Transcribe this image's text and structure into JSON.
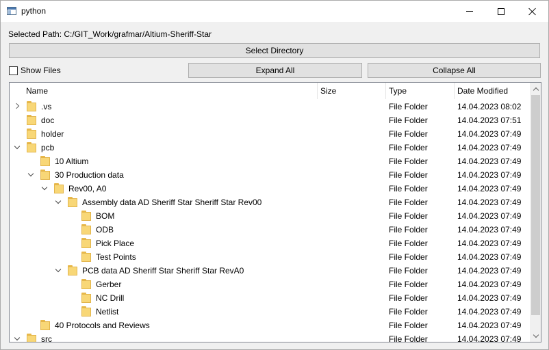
{
  "window": {
    "title": "python"
  },
  "selected_path": "Selected Path: C:/GIT_Work/grafmar/Altium-Sheriff-Star",
  "buttons": {
    "select_directory": "Select Directory",
    "expand_all": "Expand All",
    "collapse_all": "Collapse All"
  },
  "show_files": {
    "label": "Show Files",
    "checked": false
  },
  "tree": {
    "headers": {
      "name": "Name",
      "size": "Size",
      "type": "Type",
      "date": "Date Modified"
    },
    "rows": [
      {
        "name": ".vs",
        "type": "File Folder",
        "date": "14.04.2023 08:02",
        "level": 0,
        "state": "collapsed"
      },
      {
        "name": "doc",
        "type": "File Folder",
        "date": "14.04.2023 07:51",
        "level": 0,
        "state": "leaf"
      },
      {
        "name": "holder",
        "type": "File Folder",
        "date": "14.04.2023 07:49",
        "level": 0,
        "state": "leaf"
      },
      {
        "name": "pcb",
        "type": "File Folder",
        "date": "14.04.2023 07:49",
        "level": 0,
        "state": "expanded"
      },
      {
        "name": "10 Altium",
        "type": "File Folder",
        "date": "14.04.2023 07:49",
        "level": 1,
        "state": "leaf"
      },
      {
        "name": "30 Production data",
        "type": "File Folder",
        "date": "14.04.2023 07:49",
        "level": 1,
        "state": "expanded"
      },
      {
        "name": "Rev00, A0",
        "type": "File Folder",
        "date": "14.04.2023 07:49",
        "level": 2,
        "state": "expanded"
      },
      {
        "name": "Assembly data AD Sheriff Star Sheriff Star Rev00",
        "type": "File Folder",
        "date": "14.04.2023 07:49",
        "level": 3,
        "state": "expanded"
      },
      {
        "name": "BOM",
        "type": "File Folder",
        "date": "14.04.2023 07:49",
        "level": 4,
        "state": "leaf"
      },
      {
        "name": "ODB",
        "type": "File Folder",
        "date": "14.04.2023 07:49",
        "level": 4,
        "state": "leaf"
      },
      {
        "name": "Pick Place",
        "type": "File Folder",
        "date": "14.04.2023 07:49",
        "level": 4,
        "state": "leaf"
      },
      {
        "name": "Test Points",
        "type": "File Folder",
        "date": "14.04.2023 07:49",
        "level": 4,
        "state": "leaf"
      },
      {
        "name": "PCB data AD Sheriff Star Sheriff Star RevA0",
        "type": "File Folder",
        "date": "14.04.2023 07:49",
        "level": 3,
        "state": "expanded"
      },
      {
        "name": "Gerber",
        "type": "File Folder",
        "date": "14.04.2023 07:49",
        "level": 4,
        "state": "leaf"
      },
      {
        "name": "NC Drill",
        "type": "File Folder",
        "date": "14.04.2023 07:49",
        "level": 4,
        "state": "leaf"
      },
      {
        "name": "Netlist",
        "type": "File Folder",
        "date": "14.04.2023 07:49",
        "level": 4,
        "state": "leaf"
      },
      {
        "name": "40 Protocols and Reviews",
        "type": "File Folder",
        "date": "14.04.2023 07:49",
        "level": 1,
        "state": "leaf"
      },
      {
        "name": "src",
        "type": "File Folder",
        "date": "14.04.2023 07:49",
        "level": 0,
        "state": "expanded"
      }
    ]
  }
}
